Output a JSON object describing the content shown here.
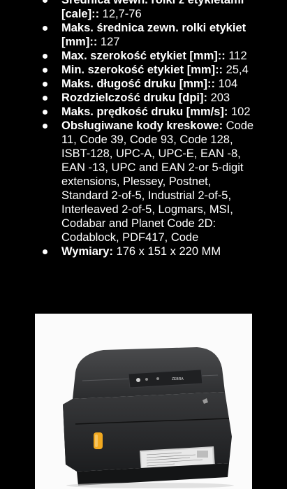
{
  "specs": [
    {
      "label": "Średnica wewn. rolki z etykietami [cale]::",
      "value": " 12,7-76"
    },
    {
      "label": "Maks. średnica zewn. rolki etykiet [mm]::",
      "value": " 127"
    },
    {
      "label": "Max. szerokość etykiet [mm]::",
      "value": " 112"
    },
    {
      "label": "Min. szerokość etykiet [mm]::",
      "value": " 25,4"
    },
    {
      "label": "Maks. długość druku [mm]::",
      "value": " 104"
    },
    {
      "label": "Rozdzielczość druku [dpi]:",
      "value": " 203"
    },
    {
      "label": "Maks. prędkość druku [mm/s]:",
      "value": " 102"
    },
    {
      "label": "Obsługiwane kody kreskowe:",
      "value": " Code 11, Code 39, Code 93, Code 128, ISBT-128, UPC-A, UPC-E, EAN -8, EAN -13, UPC and EAN 2-or 5-digit extensions, Plessey, Postnet, Standard 2-of-5, Industrial 2-of-5, Interleaved 2-of-5, Logmars, MSI, Codabar and Planet Code 2D: Codablock, PDF417, Code"
    },
    {
      "label": "Wymiary:",
      "value": " 176 x 151 x 220 MM"
    }
  ],
  "product": {
    "icon": "label-printer-photo",
    "brand_text": "ZEBRA"
  }
}
